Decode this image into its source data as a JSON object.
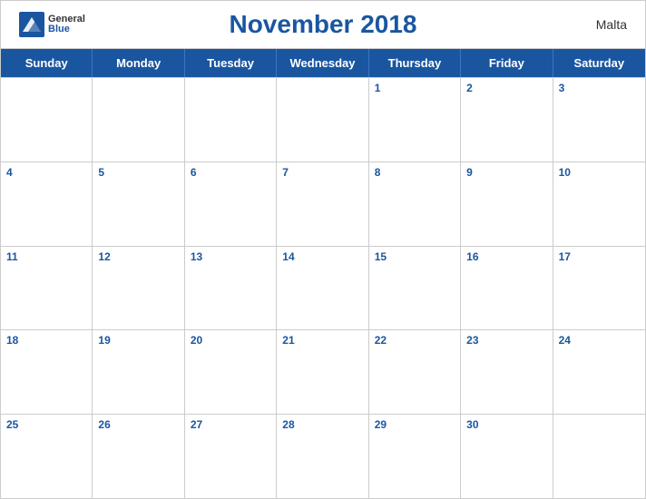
{
  "header": {
    "title": "November 2018",
    "country": "Malta",
    "logo": {
      "general": "General",
      "blue": "Blue"
    }
  },
  "days_of_week": [
    "Sunday",
    "Monday",
    "Tuesday",
    "Wednesday",
    "Thursday",
    "Friday",
    "Saturday"
  ],
  "weeks": [
    [
      {
        "date": "",
        "empty": true
      },
      {
        "date": "",
        "empty": true
      },
      {
        "date": "",
        "empty": true
      },
      {
        "date": "",
        "empty": true
      },
      {
        "date": "1"
      },
      {
        "date": "2"
      },
      {
        "date": "3"
      }
    ],
    [
      {
        "date": "4"
      },
      {
        "date": "5"
      },
      {
        "date": "6"
      },
      {
        "date": "7"
      },
      {
        "date": "8"
      },
      {
        "date": "9"
      },
      {
        "date": "10"
      }
    ],
    [
      {
        "date": "11"
      },
      {
        "date": "12"
      },
      {
        "date": "13"
      },
      {
        "date": "14"
      },
      {
        "date": "15"
      },
      {
        "date": "16"
      },
      {
        "date": "17"
      }
    ],
    [
      {
        "date": "18"
      },
      {
        "date": "19"
      },
      {
        "date": "20"
      },
      {
        "date": "21"
      },
      {
        "date": "22"
      },
      {
        "date": "23"
      },
      {
        "date": "24"
      }
    ],
    [
      {
        "date": "25"
      },
      {
        "date": "26"
      },
      {
        "date": "27"
      },
      {
        "date": "28"
      },
      {
        "date": "29"
      },
      {
        "date": "30"
      },
      {
        "date": "",
        "empty": true
      }
    ]
  ]
}
